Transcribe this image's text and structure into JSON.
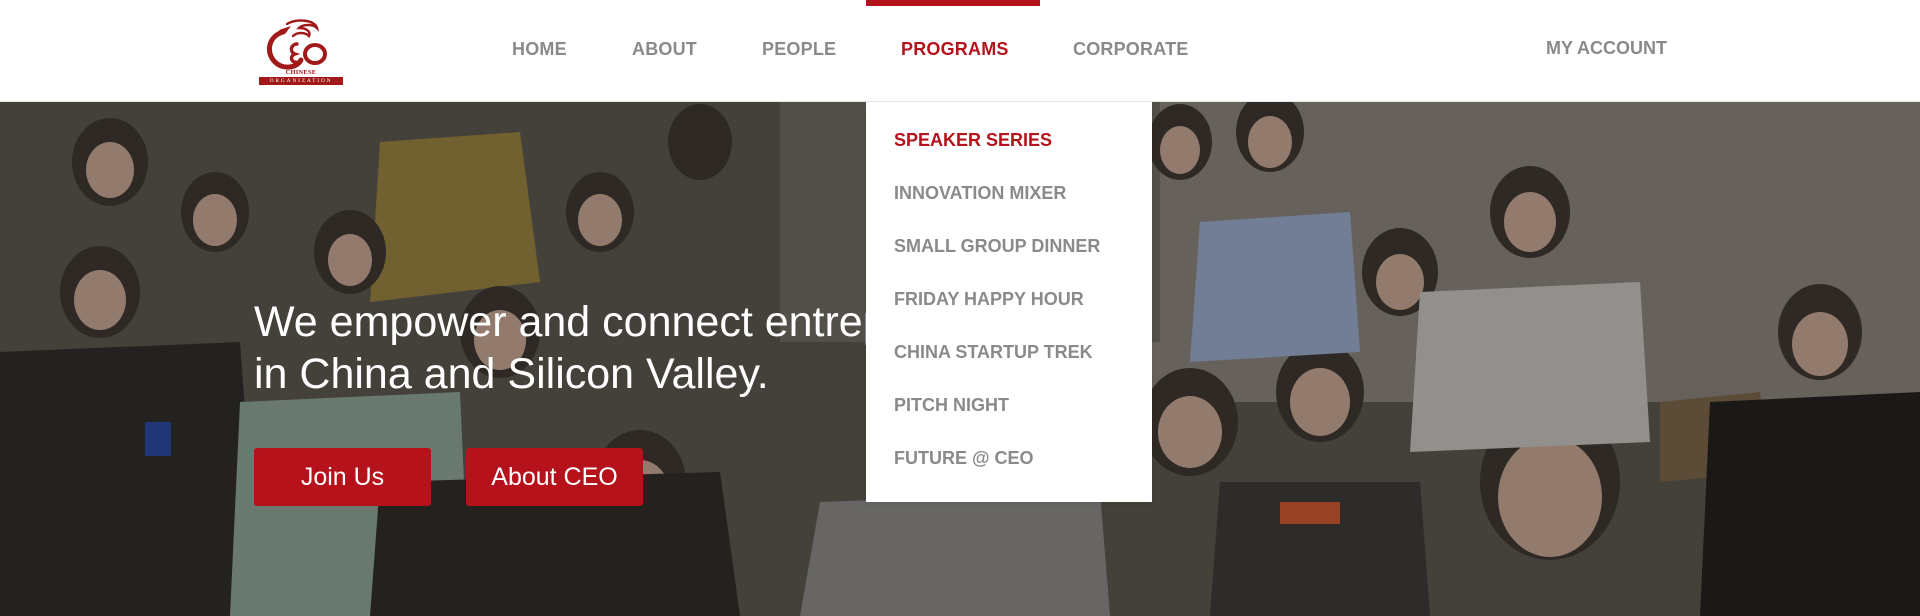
{
  "logo": {
    "mark": "CEO",
    "caption_line1": "CHINESE ENTREPRENEURS",
    "caption_line2": "ORGANIZATION"
  },
  "nav": {
    "items": [
      {
        "label": "HOME"
      },
      {
        "label": "ABOUT"
      },
      {
        "label": "PEOPLE"
      },
      {
        "label": "PROGRAMS",
        "active": true
      },
      {
        "label": "CORPORATE"
      }
    ],
    "account_label": "MY ACCOUNT"
  },
  "dropdown": {
    "items": [
      {
        "label": "SPEAKER SERIES",
        "active": true
      },
      {
        "label": "INNOVATION MIXER"
      },
      {
        "label": "SMALL GROUP DINNER"
      },
      {
        "label": "FRIDAY HAPPY HOUR"
      },
      {
        "label": "CHINA STARTUP TREK"
      },
      {
        "label": "PITCH NIGHT"
      },
      {
        "label": "FUTURE @ CEO"
      }
    ]
  },
  "hero": {
    "headline_line1": "We empower and connect entrepreneurs",
    "headline_line2": "in China and Silicon Valley.",
    "join_label": "Join Us",
    "about_label": "About CEO"
  },
  "colors": {
    "accent": "#b5121b",
    "nav_text": "#8a8a8a",
    "logo": "#a11919"
  }
}
